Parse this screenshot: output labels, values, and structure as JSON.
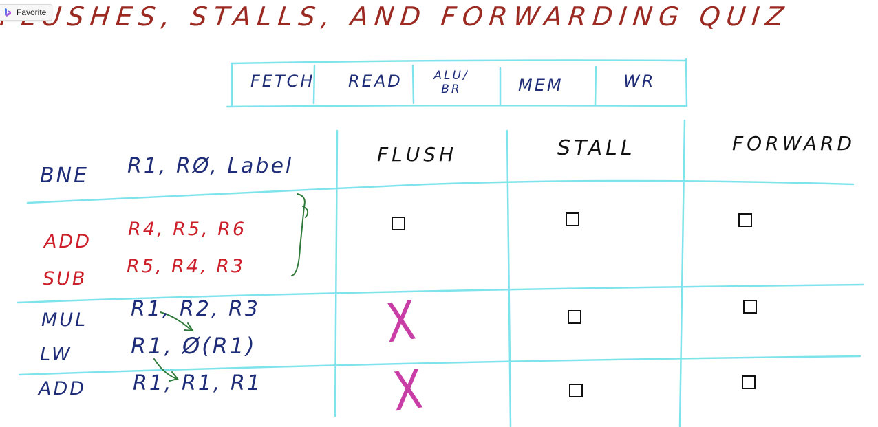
{
  "favorites_bar": {
    "label": "Favorite",
    "icon": "bing-icon"
  },
  "title": "FLUSHES, STALLS, AND FORWARDING QUIZ",
  "pipeline_stages": [
    "FETCH",
    "READ",
    "ALU/ BR",
    "MEM",
    "WR"
  ],
  "table_headers": {
    "flush": "FLUSH",
    "stall": "STALL",
    "forward": "FORWARD"
  },
  "branch_instruction": {
    "op": "BNE",
    "operands": "R1, RØ, Label"
  },
  "groups": [
    {
      "instructions": [
        {
          "op": "ADD",
          "operands": "R4, R5, R6"
        },
        {
          "op": "SUB",
          "operands": "R5, R4, R3"
        }
      ],
      "flush": "checkbox",
      "stall": "checkbox",
      "forward": "checkbox"
    },
    {
      "instructions": [
        {
          "op": "MUL",
          "operands": "R1, R2, R3"
        },
        {
          "op": "LW",
          "operands": "R1, Ø(R1)"
        }
      ],
      "flush": "X",
      "stall": "checkbox",
      "forward": "checkbox"
    },
    {
      "instructions": [
        {
          "op": "ADD",
          "operands": "R1, R1, R1"
        }
      ],
      "flush": "X",
      "stall": "checkbox",
      "forward": "checkbox"
    }
  ],
  "x_mark": "X",
  "colors": {
    "title": "#9b2b22",
    "blue_ink": "#1f2d78",
    "red_ink": "#cc1f2a",
    "grid": "#7fe3ec",
    "x_mark": "#c93da6",
    "arrow": "#2f7a3a"
  }
}
